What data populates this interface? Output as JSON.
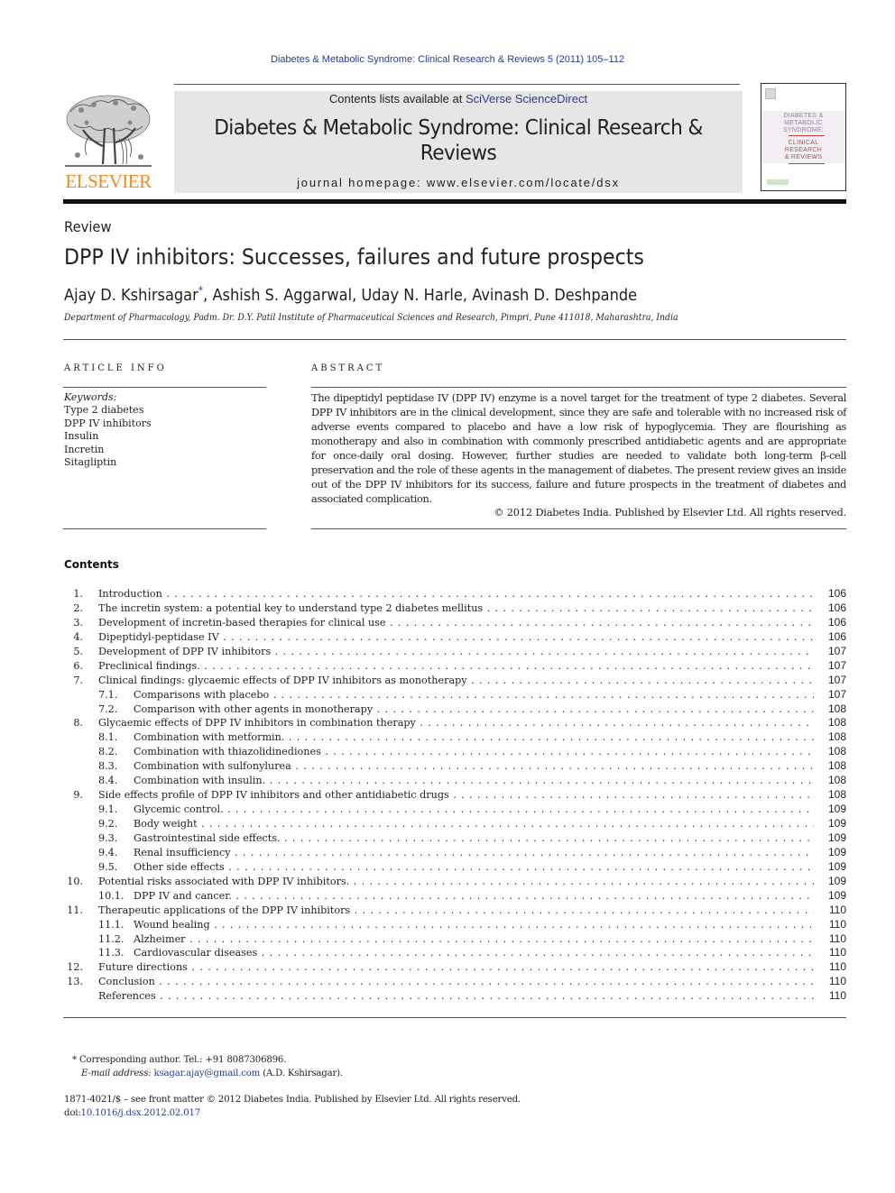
{
  "running_head": "Diabetes & Metabolic Syndrome: Clinical Research & Reviews 5 (2011) 105–112",
  "masthead": {
    "contents_prefix": "Contents lists available at ",
    "contents_link": "SciVerse ScienceDirect",
    "journal_title": "Diabetes & Metabolic Syndrome: Clinical Research & Reviews",
    "homepage_prefix": "journal homepage: ",
    "homepage_url": "www.elsevier.com/locate/dsx",
    "publisher_logo_text": "ELSEVIER",
    "cover_lines": [
      "DIABETES &",
      "METABOLIC",
      "SYNDROME:",
      "CLINICAL",
      "RESEARCH",
      "& REVIEWS"
    ],
    "colors": {
      "link": "#2a3d8f",
      "elsevier_orange": "#f08a1c",
      "masthead_bg": "#e6e6e6"
    }
  },
  "article": {
    "type": "Review",
    "title": "DPP IV inhibitors: Successes, failures and future prospects",
    "authors": [
      {
        "name": "Ajay D. Kshirsagar",
        "mark": "*"
      },
      {
        "name": "Ashish S. Aggarwal",
        "mark": ""
      },
      {
        "name": "Uday N. Harle",
        "mark": ""
      },
      {
        "name": "Avinash D. Deshpande",
        "mark": ""
      }
    ],
    "author_sep": ", ",
    "affiliation": "Department of Pharmacology, Padm. Dr. D.Y. Patil Institute of Pharmaceutical Sciences and Research, Pimpri, Pune 411018, Maharashtra, India"
  },
  "article_info": {
    "label": "ARTICLE INFO",
    "keywords_label": "Keywords:",
    "keywords": [
      "Type 2 diabetes",
      "DPP IV inhibitors",
      "Insulin",
      "Incretin",
      "Sitagliptin"
    ]
  },
  "abstract": {
    "label": "ABSTRACT",
    "text": "The dipeptidyl peptidase IV (DPP IV) enzyme is a novel target for the treatment of type 2 diabetes. Several DPP IV inhibitors are in the clinical development, since they are safe and tolerable with no increased risk of adverse events compared to placebo and have a low risk of hypoglycemia. They are flourishing as monotherapy and also in combination with commonly prescribed antidiabetic agents and are appropriate for once-daily oral dosing. However, further studies are needed to validate both long-term β-cell preservation and the role of these agents in the management of diabetes. The present review gives an inside out of the DPP IV inhibitors for its success, failure and future prospects in the treatment of diabetes and associated complication.",
    "copyright": "© 2012 Diabetes India. Published by Elsevier Ltd. All rights reserved."
  },
  "contents": {
    "heading": "Contents",
    "items": [
      {
        "num": "1.",
        "title": "Introduction",
        "page": "106",
        "level": 1
      },
      {
        "num": "2.",
        "title": "The incretin system: a potential key to understand type 2 diabetes mellitus",
        "page": "106",
        "level": 1
      },
      {
        "num": "3.",
        "title": "Development of incretin-based therapies for clinical use",
        "page": "106",
        "level": 1
      },
      {
        "num": "4.",
        "title": "Dipeptidyl-peptidase IV",
        "page": "106",
        "level": 1
      },
      {
        "num": "5.",
        "title": "Development of DPP IV inhibitors",
        "page": "107",
        "level": 1
      },
      {
        "num": "6.",
        "title": "Preclinical findings.",
        "page": "107",
        "level": 1
      },
      {
        "num": "7.",
        "title": "Clinical findings: glycaemic effects of DPP IV inhibitors as monotherapy",
        "page": "107",
        "level": 1
      },
      {
        "num": "7.1.",
        "title": "Comparisons with placebo",
        "page": "107",
        "level": 2
      },
      {
        "num": "7.2.",
        "title": "Comparison with other agents in monotherapy",
        "page": "108",
        "level": 2
      },
      {
        "num": "8.",
        "title": "Glycaemic effects of DPP IV inhibitors in combination therapy",
        "page": "108",
        "level": 1
      },
      {
        "num": "8.1.",
        "title": "Combination with metformin.",
        "page": "108",
        "level": 2
      },
      {
        "num": "8.2.",
        "title": "Combination with thiazolidinediones",
        "page": "108",
        "level": 2
      },
      {
        "num": "8.3.",
        "title": "Combination with sulfonylurea",
        "page": "108",
        "level": 2
      },
      {
        "num": "8.4.",
        "title": "Combination with insulin.",
        "page": "108",
        "level": 2
      },
      {
        "num": "9.",
        "title": "Side effects profile of DPP IV inhibitors and other antidiabetic drugs",
        "page": "108",
        "level": 1
      },
      {
        "num": "9.1.",
        "title": "Glycemic control.",
        "page": "109",
        "level": 2
      },
      {
        "num": "9.2.",
        "title": "Body weight",
        "page": "109",
        "level": 2
      },
      {
        "num": "9.3.",
        "title": "Gastrointestinal side effects.",
        "page": "109",
        "level": 2
      },
      {
        "num": "9.4.",
        "title": "Renal insufficiency",
        "page": "109",
        "level": 2
      },
      {
        "num": "9.5.",
        "title": "Other side effects",
        "page": "109",
        "level": 2
      },
      {
        "num": "10.",
        "title": "Potential risks associated with DPP IV inhibitors.",
        "page": "109",
        "level": 1
      },
      {
        "num": "10.1.",
        "title": "DPP IV and cancer.",
        "page": "109",
        "level": 2
      },
      {
        "num": "11.",
        "title": "Therapeutic applications of the DPP IV inhibitors",
        "page": "110",
        "level": 1
      },
      {
        "num": "11.1.",
        "title": "Wound healing",
        "page": "110",
        "level": 2
      },
      {
        "num": "11.2.",
        "title": "Alzheimer",
        "page": "110",
        "level": 2
      },
      {
        "num": "11.3.",
        "title": "Cardiovascular diseases",
        "page": "110",
        "level": 2
      },
      {
        "num": "12.",
        "title": "Future directions",
        "page": "110",
        "level": 1
      },
      {
        "num": "13.",
        "title": "Conclusion",
        "page": "110",
        "level": 1
      },
      {
        "num": "",
        "title": "References",
        "page": "110",
        "level": 1
      }
    ]
  },
  "footnote": {
    "mark": "*",
    "corresponding": "Corresponding author. Tel.: +91 8087306896.",
    "email_label": "E-mail address:",
    "email": "ksagar.ajay@gmail.com",
    "email_owner": "(A.D. Kshirsagar)."
  },
  "front_matter": {
    "issn_line": "1871-4021/$ – see front matter © 2012 Diabetes India. Published by Elsevier Ltd. All rights reserved.",
    "doi_prefix": "doi:",
    "doi": "10.1016/j.dsx.2012.02.017"
  }
}
